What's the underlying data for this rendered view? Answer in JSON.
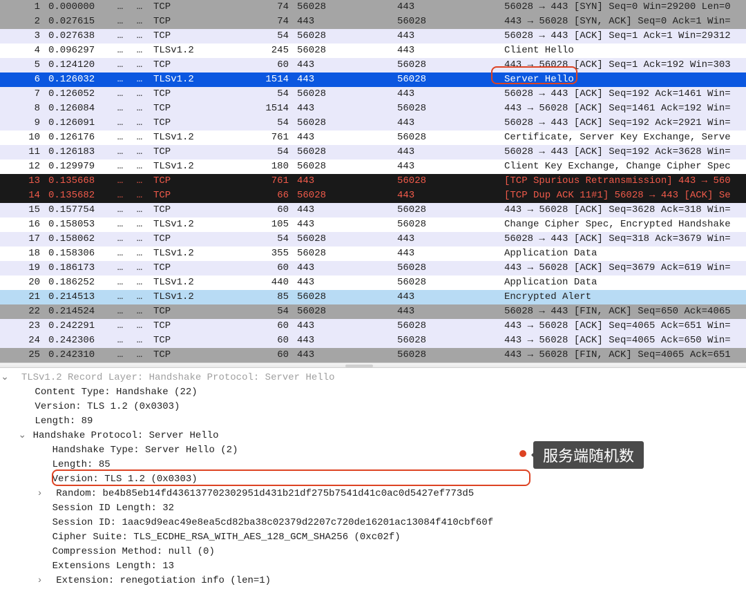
{
  "packets": [
    {
      "num": "1",
      "time": "0.000000",
      "src": "…",
      "dst": "…",
      "proto": "TCP",
      "len": "74",
      "sport": "56028",
      "dport": "443",
      "info": "56028 → 443 [SYN] Seq=0 Win=29200 Len=0",
      "style": "row-gray"
    },
    {
      "num": "2",
      "time": "0.027615",
      "src": "…",
      "dst": "…",
      "proto": "TCP",
      "len": "74",
      "sport": "443",
      "dport": "56028",
      "info": "443 → 56028 [SYN, ACK] Seq=0 Ack=1 Win=",
      "style": "row-gray"
    },
    {
      "num": "3",
      "time": "0.027638",
      "src": "…",
      "dst": "…",
      "proto": "TCP",
      "len": "54",
      "sport": "56028",
      "dport": "443",
      "info": "56028 → 443 [ACK] Seq=1 Ack=1 Win=29312",
      "style": "row-lav"
    },
    {
      "num": "4",
      "time": "0.096297",
      "src": "…",
      "dst": "…",
      "proto": "TLSv1.2",
      "len": "245",
      "sport": "56028",
      "dport": "443",
      "info": "Client Hello",
      "style": "row-white"
    },
    {
      "num": "5",
      "time": "0.124120",
      "src": "…",
      "dst": "…",
      "proto": "TCP",
      "len": "60",
      "sport": "443",
      "dport": "56028",
      "info": "443 → 56028 [ACK] Seq=1 Ack=192 Win=303",
      "style": "row-lav"
    },
    {
      "num": "6",
      "time": "0.126032",
      "src": "…",
      "dst": "…",
      "proto": "TLSv1.2",
      "len": "1514",
      "sport": "443",
      "dport": "56028",
      "info": "Server Hello",
      "style": "row-sel"
    },
    {
      "num": "7",
      "time": "0.126052",
      "src": "…",
      "dst": "…",
      "proto": "TCP",
      "len": "54",
      "sport": "56028",
      "dport": "443",
      "info": "56028 → 443 [ACK] Seq=192 Ack=1461 Win=",
      "style": "row-lav"
    },
    {
      "num": "8",
      "time": "0.126084",
      "src": "…",
      "dst": "…",
      "proto": "TCP",
      "len": "1514",
      "sport": "443",
      "dport": "56028",
      "info": "443 → 56028 [ACK] Seq=1461 Ack=192 Win=",
      "style": "row-lav"
    },
    {
      "num": "9",
      "time": "0.126091",
      "src": "…",
      "dst": "…",
      "proto": "TCP",
      "len": "54",
      "sport": "56028",
      "dport": "443",
      "info": "56028 → 443 [ACK] Seq=192 Ack=2921 Win=",
      "style": "row-lav"
    },
    {
      "num": "10",
      "time": "0.126176",
      "src": "…",
      "dst": "…",
      "proto": "TLSv1.2",
      "len": "761",
      "sport": "443",
      "dport": "56028",
      "info": "Certificate, Server Key Exchange, Serve",
      "style": "row-white"
    },
    {
      "num": "11",
      "time": "0.126183",
      "src": "…",
      "dst": "…",
      "proto": "TCP",
      "len": "54",
      "sport": "56028",
      "dport": "443",
      "info": "56028 → 443 [ACK] Seq=192 Ack=3628 Win=",
      "style": "row-lav"
    },
    {
      "num": "12",
      "time": "0.129979",
      "src": "…",
      "dst": "…",
      "proto": "TLSv1.2",
      "len": "180",
      "sport": "56028",
      "dport": "443",
      "info": "Client Key Exchange, Change Cipher Spec",
      "style": "row-white"
    },
    {
      "num": "13",
      "time": "0.135668",
      "src": "…",
      "dst": "…",
      "proto": "TCP",
      "len": "761",
      "sport": "443",
      "dport": "56028",
      "info": "[TCP Spurious Retransmission] 443 → 560",
      "style": "row-dark"
    },
    {
      "num": "14",
      "time": "0.135682",
      "src": "…",
      "dst": "…",
      "proto": "TCP",
      "len": "66",
      "sport": "56028",
      "dport": "443",
      "info": "[TCP Dup ACK 11#1] 56028 → 443 [ACK] Se",
      "style": "row-dark"
    },
    {
      "num": "15",
      "time": "0.157754",
      "src": "…",
      "dst": "…",
      "proto": "TCP",
      "len": "60",
      "sport": "443",
      "dport": "56028",
      "info": "443 → 56028 [ACK] Seq=3628 Ack=318 Win=",
      "style": "row-lav"
    },
    {
      "num": "16",
      "time": "0.158053",
      "src": "…",
      "dst": "…",
      "proto": "TLSv1.2",
      "len": "105",
      "sport": "443",
      "dport": "56028",
      "info": "Change Cipher Spec, Encrypted Handshake",
      "style": "row-white"
    },
    {
      "num": "17",
      "time": "0.158062",
      "src": "…",
      "dst": "…",
      "proto": "TCP",
      "len": "54",
      "sport": "56028",
      "dport": "443",
      "info": "56028 → 443 [ACK] Seq=318 Ack=3679 Win=",
      "style": "row-lav"
    },
    {
      "num": "18",
      "time": "0.158306",
      "src": "…",
      "dst": "…",
      "proto": "TLSv1.2",
      "len": "355",
      "sport": "56028",
      "dport": "443",
      "info": "Application Data",
      "style": "row-white"
    },
    {
      "num": "19",
      "time": "0.186173",
      "src": "…",
      "dst": "…",
      "proto": "TCP",
      "len": "60",
      "sport": "443",
      "dport": "56028",
      "info": "443 → 56028 [ACK] Seq=3679 Ack=619 Win=",
      "style": "row-lav"
    },
    {
      "num": "20",
      "time": "0.186252",
      "src": "…",
      "dst": "…",
      "proto": "TLSv1.2",
      "len": "440",
      "sport": "443",
      "dport": "56028",
      "info": "Application Data",
      "style": "row-white"
    },
    {
      "num": "21",
      "time": "0.214513",
      "src": "…",
      "dst": "…",
      "proto": "TLSv1.2",
      "len": "85",
      "sport": "56028",
      "dport": "443",
      "info": "Encrypted Alert",
      "style": "row-lightblue"
    },
    {
      "num": "22",
      "time": "0.214524",
      "src": "…",
      "dst": "…",
      "proto": "TCP",
      "len": "54",
      "sport": "56028",
      "dport": "443",
      "info": "56028 → 443 [FIN, ACK] Seq=650 Ack=4065",
      "style": "row-gray"
    },
    {
      "num": "23",
      "time": "0.242291",
      "src": "…",
      "dst": "…",
      "proto": "TCP",
      "len": "60",
      "sport": "443",
      "dport": "56028",
      "info": "443 → 56028 [ACK] Seq=4065 Ack=651 Win=",
      "style": "row-lav"
    },
    {
      "num": "24",
      "time": "0.242306",
      "src": "…",
      "dst": "…",
      "proto": "TCP",
      "len": "60",
      "sport": "443",
      "dport": "56028",
      "info": "443 → 56028 [ACK] Seq=4065 Ack=650 Win=",
      "style": "row-lav"
    },
    {
      "num": "25",
      "time": "0.242310",
      "src": "…",
      "dst": "…",
      "proto": "TCP",
      "len": "60",
      "sport": "443",
      "dport": "56028",
      "info": "443 → 56028 [FIN, ACK] Seq=4065 Ack=651",
      "style": "row-gray"
    }
  ],
  "details": {
    "l0_cut": "TLSv1.2 Record Layer: Handshake Protocol: Server Hello",
    "l1": "Content Type: Handshake (22)",
    "l2": "Version: TLS 1.2 (0x0303)",
    "l3": "Length: 89",
    "l4": "Handshake Protocol: Server Hello",
    "l5": "Handshake Type: Server Hello (2)",
    "l6": "Length: 85",
    "l7": "Version: TLS 1.2 (0x0303)",
    "l8": "Random: be4b85eb14fd436137702302951d431b21df275b7541d41c0ac0d5427ef773d5",
    "l9": "Session ID Length: 32",
    "l10": "Session ID: 1aac9d9eac49e8ea5cd82ba38c02379d2207c720de16201ac13084f410cbf60f",
    "l11": "Cipher Suite: TLS_ECDHE_RSA_WITH_AES_128_GCM_SHA256 (0xc02f)",
    "l12": "Compression Method: null (0)",
    "l13": "Extensions Length: 13",
    "l14": "Extension: renegotiation info (len=1)"
  },
  "callout": {
    "text": "服务端随机数"
  }
}
